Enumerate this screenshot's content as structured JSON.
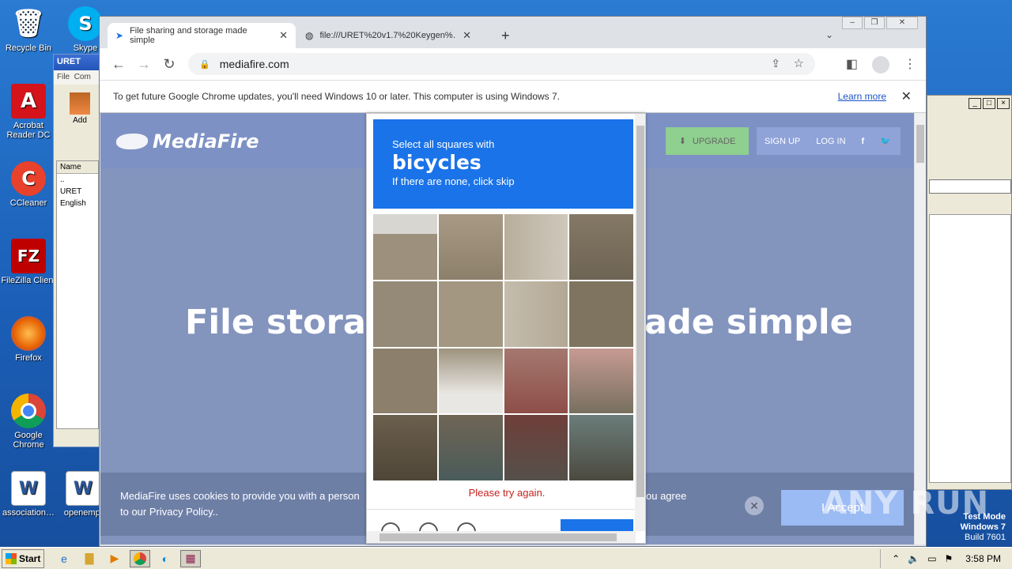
{
  "desktop": {
    "icons": [
      {
        "label": "Recycle Bin",
        "name": "recycle-bin-icon",
        "glyph": "🗑"
      },
      {
        "label": "Acrobat Reader DC",
        "name": "acrobat-icon",
        "glyph": "A"
      },
      {
        "label": "CCleaner",
        "name": "ccleaner-icon",
        "glyph": "C"
      },
      {
        "label": "FileZilla Client",
        "name": "filezilla-icon",
        "glyph": "FZ"
      },
      {
        "label": "Firefox",
        "name": "firefox-icon",
        "glyph": "🦊"
      },
      {
        "label": "Google Chrome",
        "name": "chrome-icon",
        "glyph": "◉"
      },
      {
        "label": "association…",
        "name": "word-doc-icon",
        "glyph": "W"
      }
    ],
    "skype_label": "Skype",
    "openemp_label": "openempl"
  },
  "winrar": {
    "title": "URET",
    "menu_file": "File",
    "menu_com": "Com",
    "add_label": "Add",
    "col_name": "Name",
    "files": [
      "..",
      "URET",
      "English"
    ]
  },
  "browser": {
    "tabs": [
      {
        "title": "File sharing and storage made simple"
      },
      {
        "title": "file:///URET%20v1.7%20Keygen%…"
      }
    ],
    "new_tab": "+",
    "url": "mediafire.com",
    "infobar_text": "To get future Google Chrome updates, you'll need Windows 10 or later. This computer is using Windows 7.",
    "infobar_link": "Learn more"
  },
  "mediafire": {
    "logo": "MediaFire",
    "upgrade": "UPGRADE",
    "signup": "SIGN UP",
    "login": "LOG IN",
    "hero_left": "File storag",
    "hero_right": "ade simple",
    "cookie_line1": "MediaFire uses cookies to provide you with a person",
    "cookie_line2": "to our Privacy Policy..",
    "cookie_line3": "ou agree",
    "accept": "I Accept"
  },
  "captcha": {
    "instruction": "Select all squares with",
    "object": "bicycles",
    "sub": "If there are none, click skip",
    "error": "Please try again.",
    "skip": "SKIP"
  },
  "taskbar": {
    "start": "Start",
    "time": "3:58 PM"
  },
  "watermark": {
    "line1": "Test Mode",
    "line2": "Windows 7",
    "line3": "Build 7601",
    "brand": "ANY RUN"
  }
}
